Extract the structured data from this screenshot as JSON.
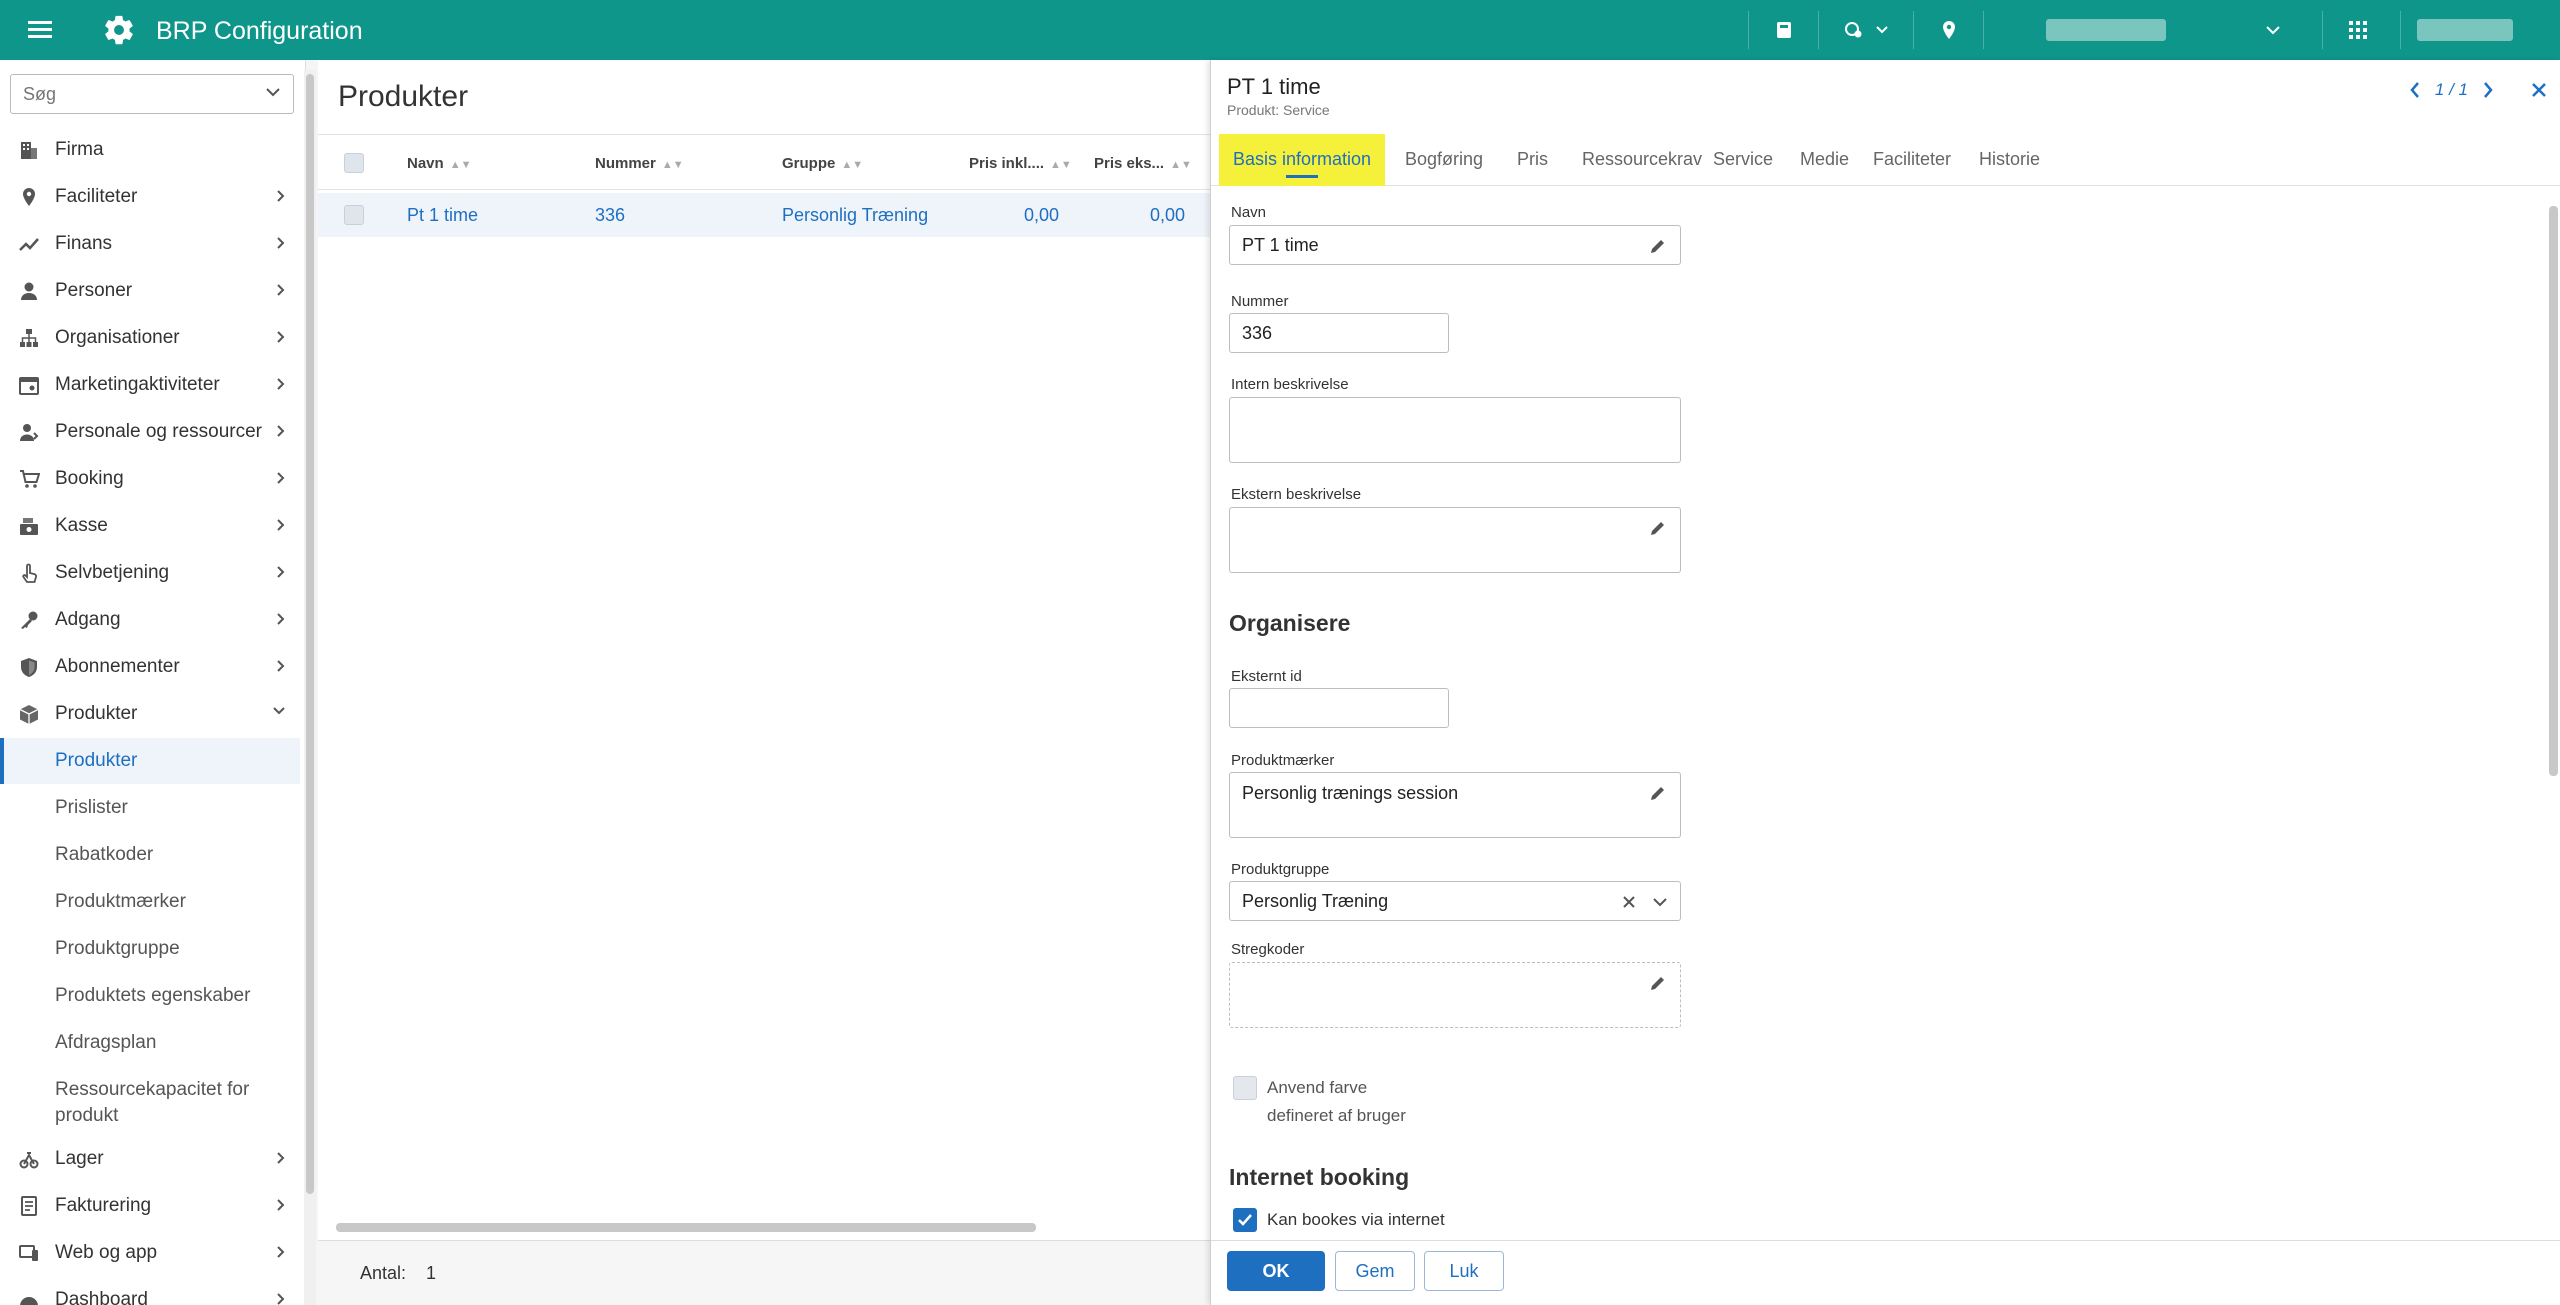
{
  "app": {
    "title": "BRP Configuration"
  },
  "sidebar": {
    "search_placeholder": "Søg",
    "items": [
      {
        "label": "Firma"
      },
      {
        "label": "Faciliteter"
      },
      {
        "label": "Finans"
      },
      {
        "label": "Personer"
      },
      {
        "label": "Organisationer"
      },
      {
        "label": "Marketingaktiviteter"
      },
      {
        "label": "Personale og ressourcer"
      },
      {
        "label": "Booking"
      },
      {
        "label": "Kasse"
      },
      {
        "label": "Selvbetjening"
      },
      {
        "label": "Adgang"
      },
      {
        "label": "Abonnementer"
      },
      {
        "label": "Produkter"
      }
    ],
    "sub_items": [
      {
        "label": "Produkter"
      },
      {
        "label": "Prislister"
      },
      {
        "label": "Rabatkoder"
      },
      {
        "label": "Produktmærker"
      },
      {
        "label": "Produktgruppe"
      },
      {
        "label": "Produktets egenskaber"
      },
      {
        "label": "Afdragsplan"
      },
      {
        "label": "Ressourcekapacitet for"
      },
      {
        "label": "produkt"
      }
    ],
    "items_after": [
      {
        "label": "Lager"
      },
      {
        "label": "Fakturering"
      },
      {
        "label": "Web og app"
      },
      {
        "label": "Dashboard"
      }
    ]
  },
  "list": {
    "title": "Produkter",
    "columns": [
      "Navn",
      "Nummer",
      "Gruppe",
      "Pris inkl....",
      "Pris eks..."
    ],
    "rows": [
      {
        "navn": "Pt 1 time",
        "nummer": "336",
        "gruppe": "Personlig Træning",
        "pris_inkl": "0,00",
        "pris_eks": "0,00"
      }
    ],
    "footer_label": "Antal:",
    "footer_count": "1"
  },
  "detail": {
    "title": "PT 1 time",
    "subtitle": "Produkt: Service",
    "pager": "1 / 1",
    "tabs": [
      "Basis information",
      "Bogføring",
      "Pris",
      "Ressourcekrav",
      "Service",
      "Medie",
      "Faciliteter",
      "Historie"
    ],
    "fields": {
      "navn_label": "Navn",
      "navn_value": "PT 1 time",
      "nummer_label": "Nummer",
      "nummer_value": "336",
      "intern_label": "Intern beskrivelse",
      "ekstern_label": "Ekstern beskrivelse",
      "organisere_heading": "Organisere",
      "eksternt_id_label": "Eksternt id",
      "produktmaerker_label": "Produktmærker",
      "produktmaerker_value": "Personlig trænings session",
      "produktgruppe_label": "Produktgruppe",
      "produktgruppe_value": "Personlig Træning",
      "stregkoder_label": "Stregkoder",
      "anvend_farve_line1": "Anvend farve",
      "anvend_farve_line2": "defineret af bruger",
      "internet_heading": "Internet booking",
      "kan_bookes_label": "Kan bookes via internet"
    },
    "buttons": {
      "ok": "OK",
      "gem": "Gem",
      "luk": "Luk"
    }
  },
  "colors": {
    "topbar": "#0f968b",
    "accent": "#1f6fc1",
    "tab_highlight": "#f5f03a"
  }
}
